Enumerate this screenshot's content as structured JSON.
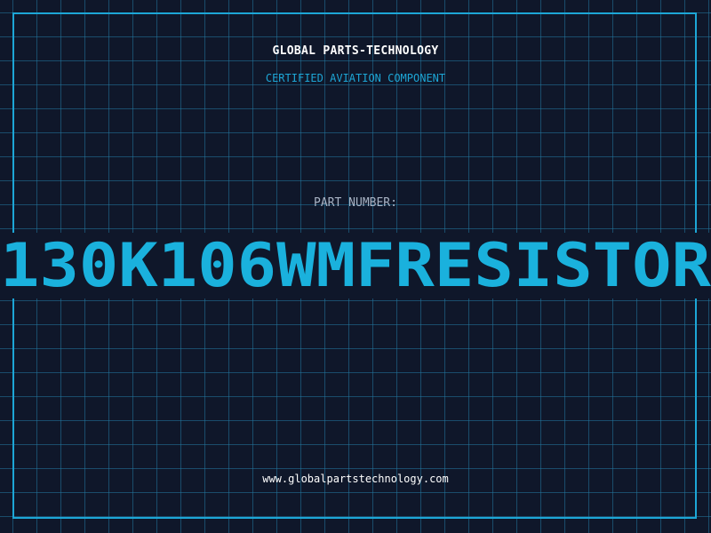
{
  "label": {
    "company": "GLOBAL PARTS-TECHNOLOGY",
    "tagline": "CERTIFIED AVIATION COMPONENT",
    "part_number_label": "PART NUMBER:",
    "part_number": "130K106WMFRESISTOR",
    "website": "www.globalpartstechnology.com"
  },
  "colors": {
    "background": "#0f172a",
    "grid": "#2278a0",
    "accent": "#1da6d6",
    "part_number": "#1ab1dd",
    "text": "#ffffff",
    "muted_text": "#a8b3c4"
  }
}
